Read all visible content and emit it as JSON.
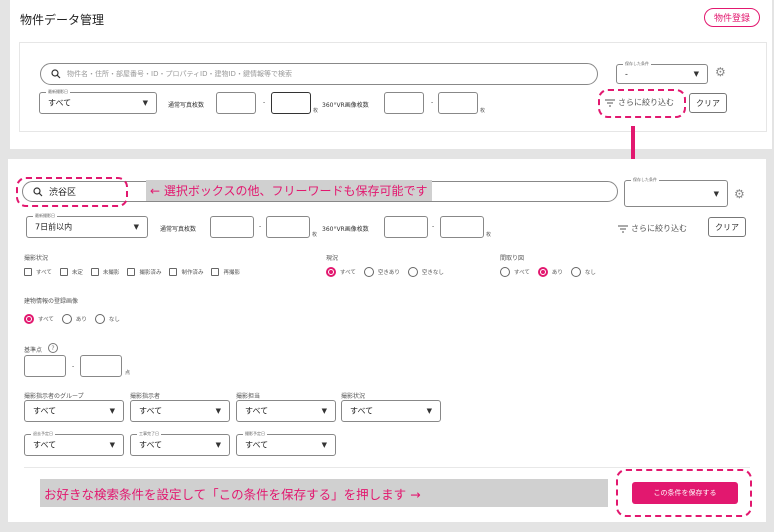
{
  "page_title": "物件データ管理",
  "register_button": "物件登録",
  "search": {
    "placeholder": "物件名・住所・部屋番号・ID・プロパティID・建物ID・鍵情報等で検索",
    "value": "渋谷区"
  },
  "saved_condition": {
    "label": "保存した条件",
    "value": "-"
  },
  "shoot_date": {
    "label": "最新撮影日",
    "value_top": "すべて",
    "value_bottom": "7日前以内"
  },
  "photo_count_label": "通常写真枚数",
  "vr_count_label": "360°VR画像枚数",
  "dash": "-",
  "unit_sheets": "枚",
  "filter_link": "さらに絞り込む",
  "clear_button": "クリア",
  "annotation_top": "← 選択ボックスの他、フリーワードも保存可能です",
  "annotation_bottom": "お好きな検索条件を設定して「この条件を保存する」を押します →",
  "shoot_status": {
    "label": "撮影状況",
    "options": [
      "すべて",
      "未定",
      "未撮影",
      "撮影済み",
      "制作済み",
      "再撮影"
    ]
  },
  "vacancy": {
    "label": "現況",
    "options": [
      "すべて",
      "空きあり",
      "空きなし"
    ],
    "selected": 0
  },
  "floorplan": {
    "label": "間取り図",
    "options": [
      "すべて",
      "あり",
      "なし"
    ],
    "selected": 1
  },
  "building_image": {
    "label": "建物情報の登録画像",
    "options": [
      "すべて",
      "あり",
      "なし"
    ],
    "selected": 0
  },
  "base_points": {
    "label": "基準点",
    "help": "?",
    "unit": "点"
  },
  "dropdowns_row1": [
    {
      "label": "撮影指示者のグループ",
      "value": "すべて"
    },
    {
      "label": "撮影指示者",
      "value": "すべて"
    },
    {
      "label": "撮影担当",
      "value": "すべて"
    },
    {
      "label": "撮影状況",
      "value": "すべて"
    }
  ],
  "dropdowns_row2": [
    {
      "label": "退去予定日",
      "value": "すべて"
    },
    {
      "label": "工事完了日",
      "value": "すべて"
    },
    {
      "label": "撮影予定日",
      "value": "すべて"
    }
  ],
  "save_button": "この条件を保存する",
  "colors": {
    "accent": "#e2186f",
    "background": "#e4e4e4",
    "annotation_bg": "#d0d0d0"
  }
}
